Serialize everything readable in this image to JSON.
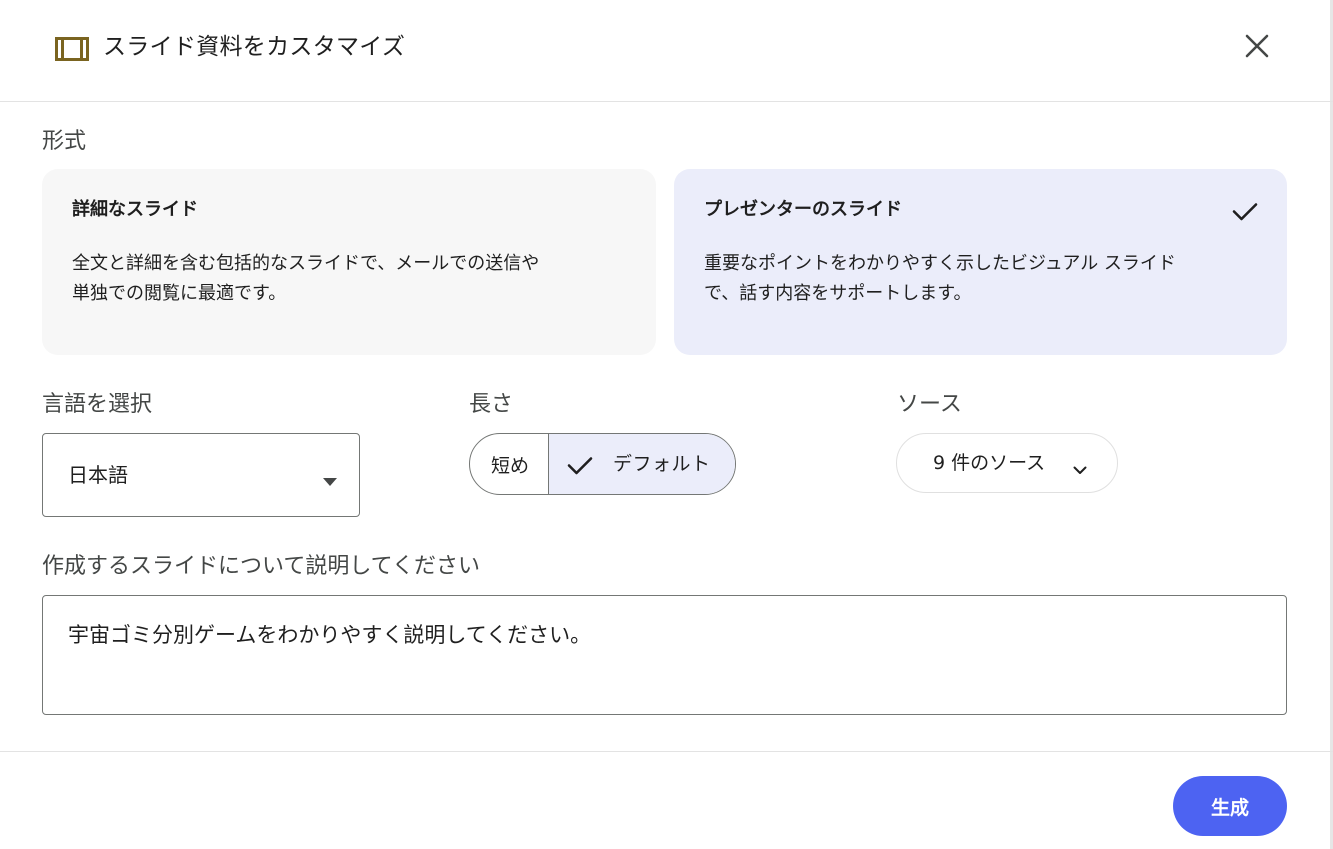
{
  "dialog": {
    "title": "スライド資料をカスタマイズ",
    "icon": "slides-icon",
    "close_icon": "close-icon"
  },
  "format": {
    "label": "形式",
    "options": [
      {
        "title": "詳細なスライド",
        "desc_line1": "全文と詳細を含む包括的なスライドで、メールでの送信や",
        "desc_line2": "単独での閲覧に最適です。",
        "selected": false
      },
      {
        "title": "プレゼンターのスライド",
        "desc_line1": "重要なポイントをわかりやすく示したビジュアル スライド",
        "desc_line2": "で、話す内容をサポートします。",
        "selected": true
      }
    ]
  },
  "language": {
    "label": "言語を選択",
    "value": "日本語"
  },
  "length": {
    "label": "長さ",
    "options": [
      {
        "label": "短め",
        "selected": false
      },
      {
        "label": "デフォルト",
        "selected": true
      }
    ]
  },
  "sources": {
    "label": "ソース",
    "button_label": "9 件のソース"
  },
  "description": {
    "label": "作成するスライドについて説明してください",
    "value": "宇宙ゴミ分別ゲームをわかりやすく説明してください。"
  },
  "footer": {
    "generate_label": "生成"
  },
  "colors": {
    "accent": "#4d63f2",
    "selected_bg": "#ebedfa",
    "card_bg": "#f7f7f7",
    "icon_gold": "#7a6420"
  }
}
